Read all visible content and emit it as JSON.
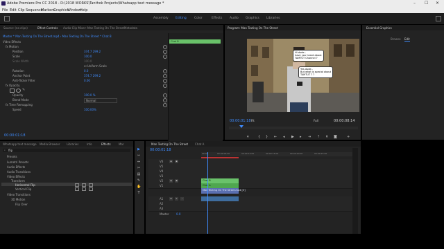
{
  "window": {
    "title": "Adobe Premiere Pro CC 2018 - D:\\2018 WORKS\\Tanthok Projects\\Whatsapp text message *",
    "controls": [
      "–",
      "☐",
      "✕"
    ]
  },
  "menu": [
    "File",
    "Edit",
    "Clip",
    "Sequence",
    "Markers",
    "Graphics",
    "Window",
    "Help"
  ],
  "workspaces": [
    {
      "label": "Assembly",
      "active": false
    },
    {
      "label": "Editing",
      "active": true
    },
    {
      "label": "Color",
      "active": false
    },
    {
      "label": "Effects",
      "active": false
    },
    {
      "label": "Audio",
      "active": false
    },
    {
      "label": "Graphics",
      "active": false
    },
    {
      "label": "Libraries",
      "active": false
    }
  ],
  "effect_controls": {
    "tabs": [
      "Source: (no clips)",
      "Effect Controls",
      "Audio Clip Mixer: Man Texting On The Street",
      "Metadata"
    ],
    "active_tab": "Effect Controls",
    "clip_path": "Master * Man Texting On The Street.mp4 › Man Texting On The Street * Chat B",
    "timeline_clip_label": "Chat B",
    "rows": [
      {
        "label": "Video Effects",
        "value": ""
      },
      {
        "label": "fx  Motion",
        "value": ""
      },
      {
        "label": "Position",
        "value": "374.7    299.2"
      },
      {
        "label": "Scale",
        "value": "100.0"
      },
      {
        "label": "Scale Width",
        "value": "100.0"
      },
      {
        "label": "",
        "value": "☑ Uniform Scale"
      },
      {
        "label": "Rotation",
        "value": "0.0"
      },
      {
        "label": "Anchor Point",
        "value": "374.7    299.2"
      },
      {
        "label": "Anti-flicker Filter",
        "value": "0.00"
      },
      {
        "label": "fx  Opacity",
        "value": ""
      },
      {
        "label": "Opacity",
        "value": "100.0 %"
      },
      {
        "label": "Blend Mode",
        "value": "Normal"
      },
      {
        "label": "fx  Time Remapping",
        "value": ""
      },
      {
        "label": "Speed",
        "value": "100.00%"
      }
    ],
    "timecode": "00:00:01:18"
  },
  "program": {
    "title": "Program: Man Texting On The Street",
    "bubbles": [
      "Hi dude..\nhave you heard about\nTAMTUT Channel ?",
      "Yes dude..\nBut what is special about\nTAMTUT ? ?"
    ],
    "timecode": "00:00:01:18",
    "fit": "Fit",
    "quality": "Full",
    "duration": "00:00:08:14"
  },
  "essential_graphics": {
    "title": "Essential Graphics",
    "tabs": [
      "Browse",
      "Edit"
    ],
    "active_tab": "Edit"
  },
  "project": {
    "tabs": [
      "Whatsapp text message",
      "Media Browser",
      "Libraries",
      "Info",
      "Effects",
      "Mar"
    ],
    "active_tab": "Effects",
    "search_placeholder": "flip",
    "tree": [
      {
        "label": "Presets",
        "indent": 1
      },
      {
        "label": "Lumetri Presets",
        "indent": 1
      },
      {
        "label": "Audio Effects",
        "indent": 1
      },
      {
        "label": "Audio Transitions",
        "indent": 1
      },
      {
        "label": "Video Effects",
        "indent": 1
      },
      {
        "label": "Transform",
        "indent": 2
      },
      {
        "label": "Horizontal Flip",
        "indent": 3,
        "selected": true
      },
      {
        "label": "Vertical Flip",
        "indent": 3
      },
      {
        "label": "Video Transitions",
        "indent": 1
      },
      {
        "label": "3D Motion",
        "indent": 2
      },
      {
        "label": "Flip Over",
        "indent": 3
      }
    ]
  },
  "tools": [
    "▶",
    "⇿",
    "⇔",
    "✂",
    "▤",
    "✎",
    "✋",
    "T"
  ],
  "timeline": {
    "tabs": [
      "Man Texting On The Street",
      "Chat A"
    ],
    "active_tab": "Man Texting On The Street",
    "timecode": "00:00:01:18",
    "ticks": [
      "00:00",
      "00:00:05:00",
      "00:00:10:00",
      "00:00:15:00",
      "00:00:20:00",
      "00:00:25:00"
    ],
    "tracks": [
      {
        "name": "V6"
      },
      {
        "name": "V5"
      },
      {
        "name": "V4"
      },
      {
        "name": "V3"
      },
      {
        "name": "V2"
      },
      {
        "name": "V1"
      },
      {
        "name": "A1"
      },
      {
        "name": "A2"
      },
      {
        "name": "A3"
      }
    ],
    "clips": {
      "chat_b": "Chat B",
      "chat_a": "Chat A",
      "video": "Man Texting On The Street.mp4 [V]",
      "master": "Master"
    },
    "master_value": "0.0"
  },
  "colors": {
    "accent": "#3f8cff",
    "clip_green": "#6ac26a",
    "clip_blue": "#5a6fb0"
  }
}
